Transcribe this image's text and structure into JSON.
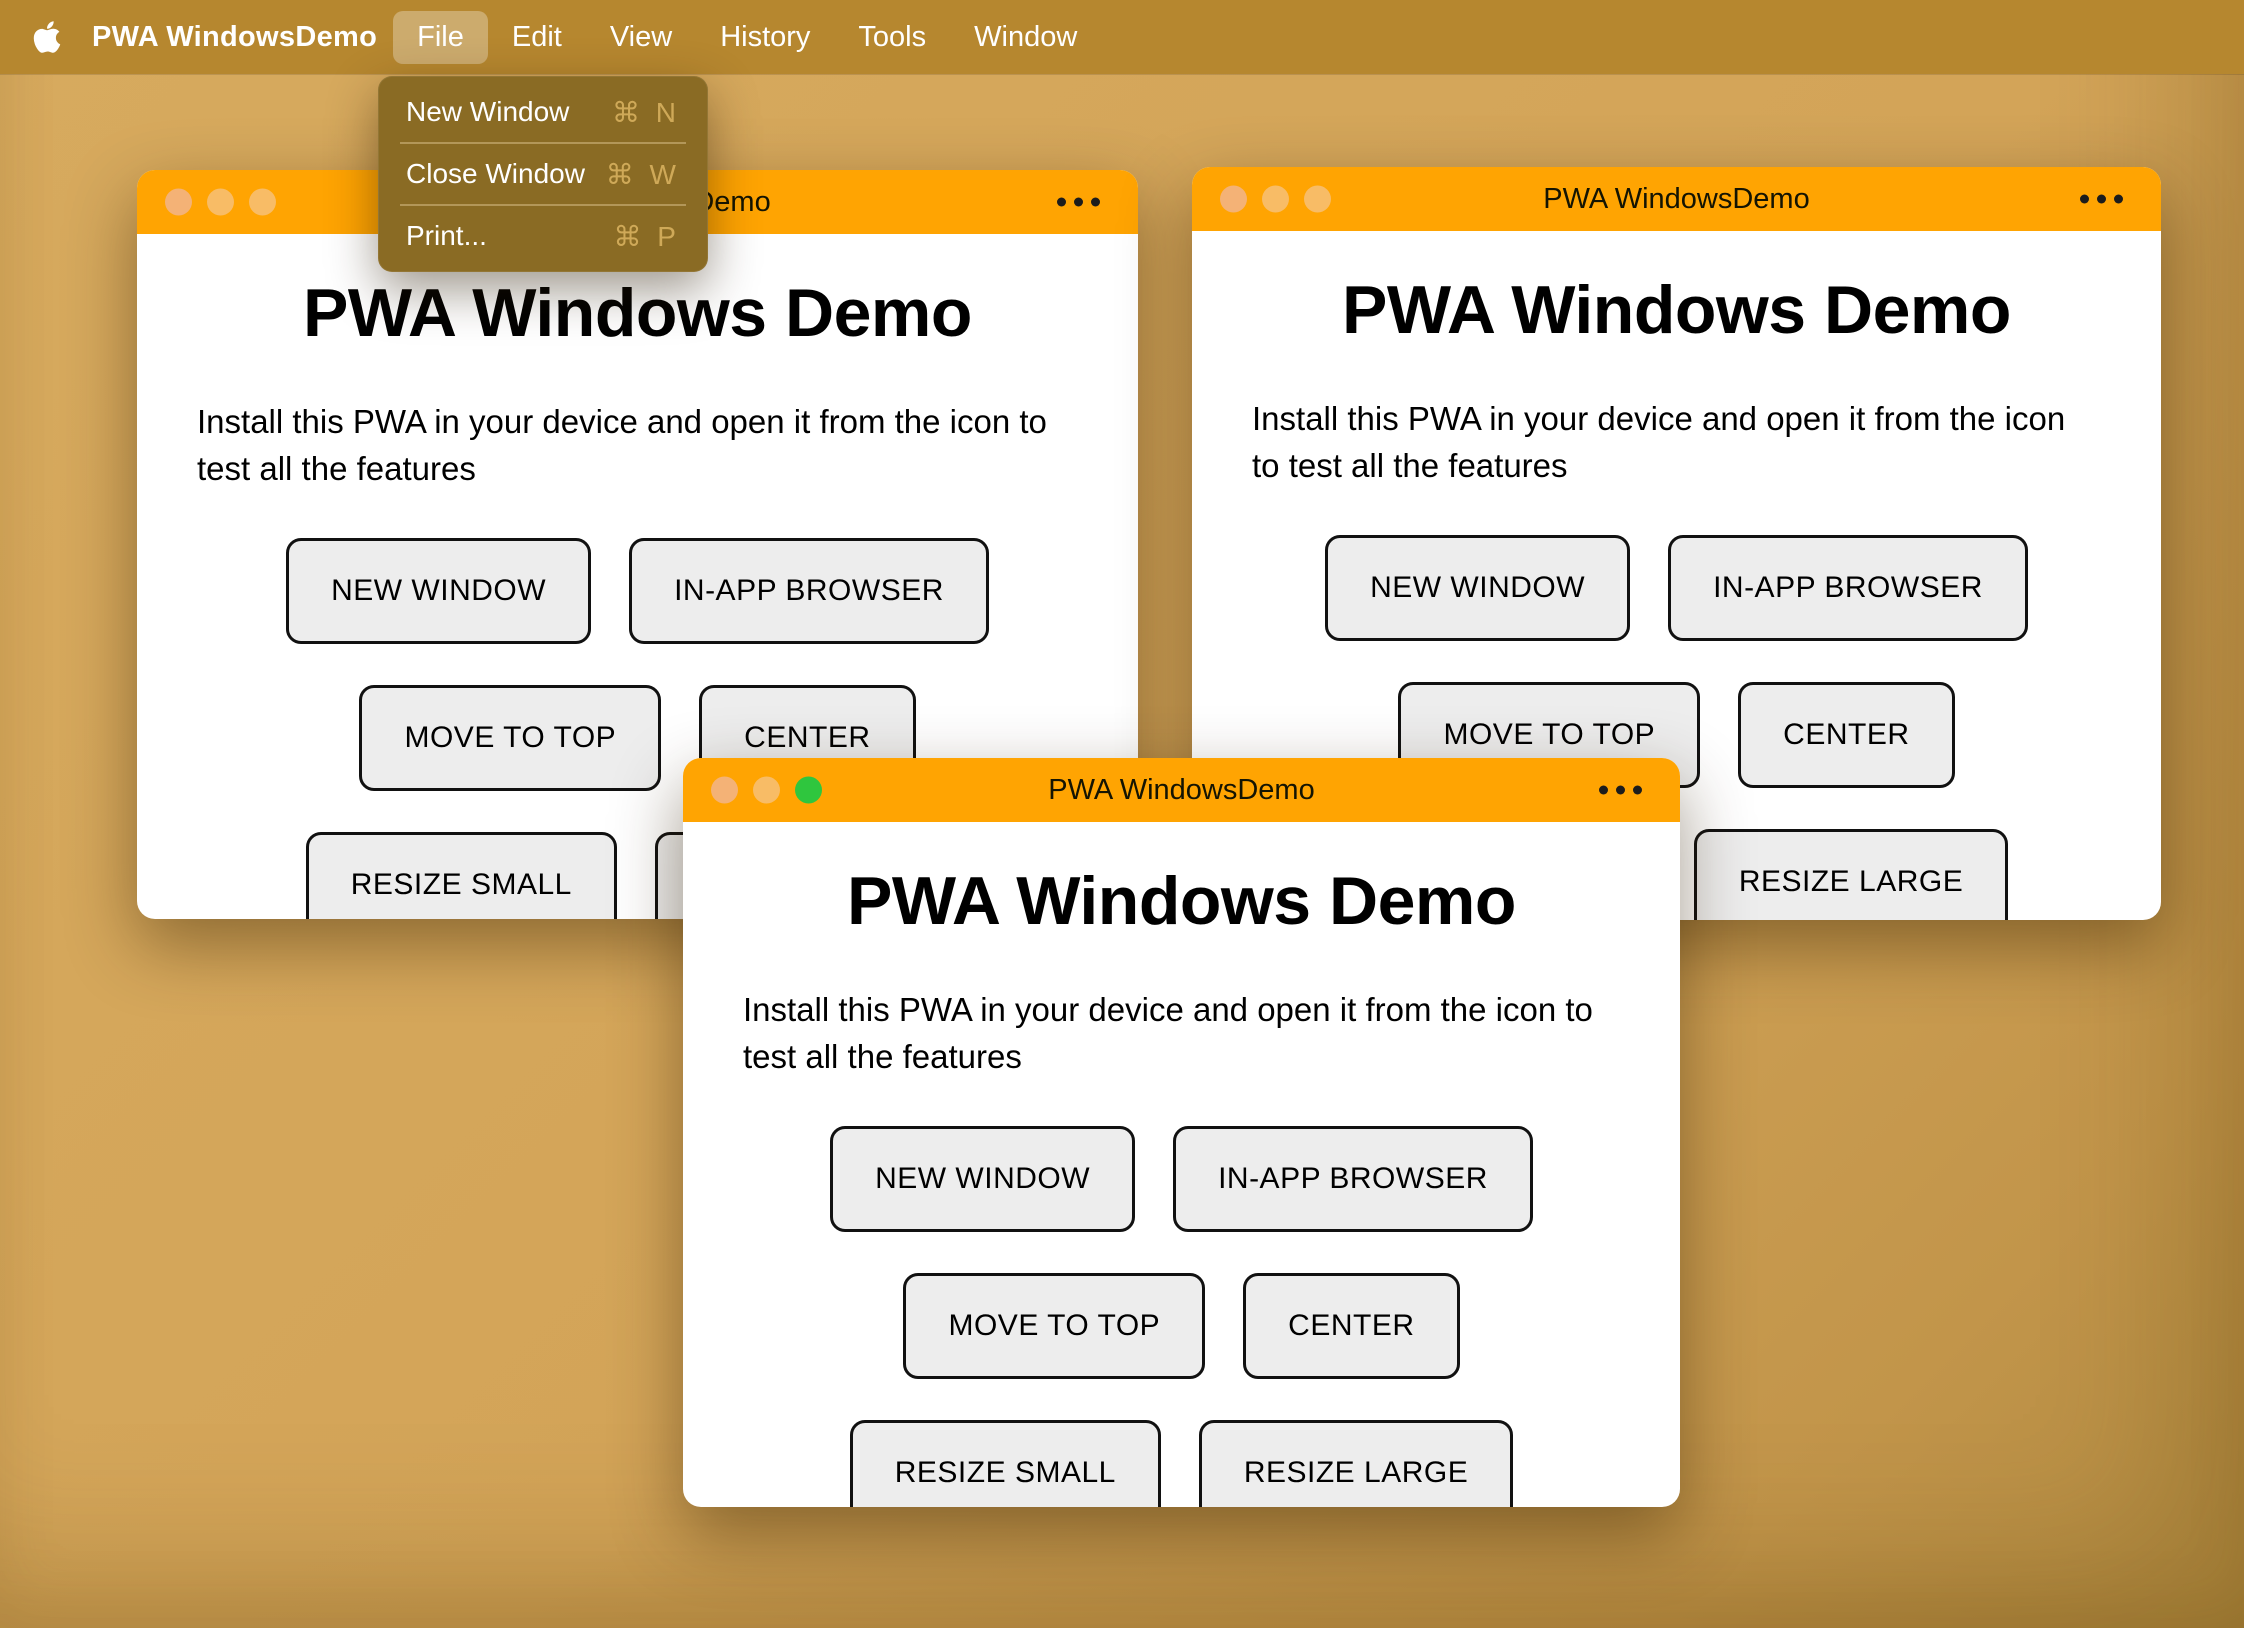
{
  "colors": {
    "desktop": "#d3a458",
    "menubar_bg": "#b6872f",
    "dropdown_bg": "#8a6b24",
    "accent_text": "#cfa958",
    "titlebar": "#ffa402",
    "traffic_dim": "#f8bc66",
    "traffic_dim_red": "#f4b276",
    "traffic_green": "#2fc63e",
    "button_bg": "#ededed"
  },
  "menubar": {
    "app_name": "PWA WindowsDemo",
    "items": [
      {
        "label": "File"
      },
      {
        "label": "Edit"
      },
      {
        "label": "View"
      },
      {
        "label": "History"
      },
      {
        "label": "Tools"
      },
      {
        "label": "Window"
      }
    ]
  },
  "file_menu": {
    "items": [
      {
        "label": "New Window",
        "shortcut": "⌘ N"
      },
      {
        "label": "Close Window",
        "shortcut": "⌘ W"
      },
      {
        "label": "Print...",
        "shortcut": "⌘ P"
      }
    ]
  },
  "windows": [
    {
      "title": "PWA WindowsDemo"
    },
    {
      "title": "PWA WindowsDemo"
    },
    {
      "title": "PWA WindowsDemo"
    }
  ],
  "window_content": {
    "heading": "PWA Windows Demo",
    "description": "Install this PWA in your device and open it from the icon to test all the features",
    "buttons": [
      "NEW WINDOW",
      "IN-APP BROWSER",
      "MOVE TO TOP",
      "CENTER",
      "RESIZE SMALL",
      "RESIZE LARGE"
    ]
  }
}
